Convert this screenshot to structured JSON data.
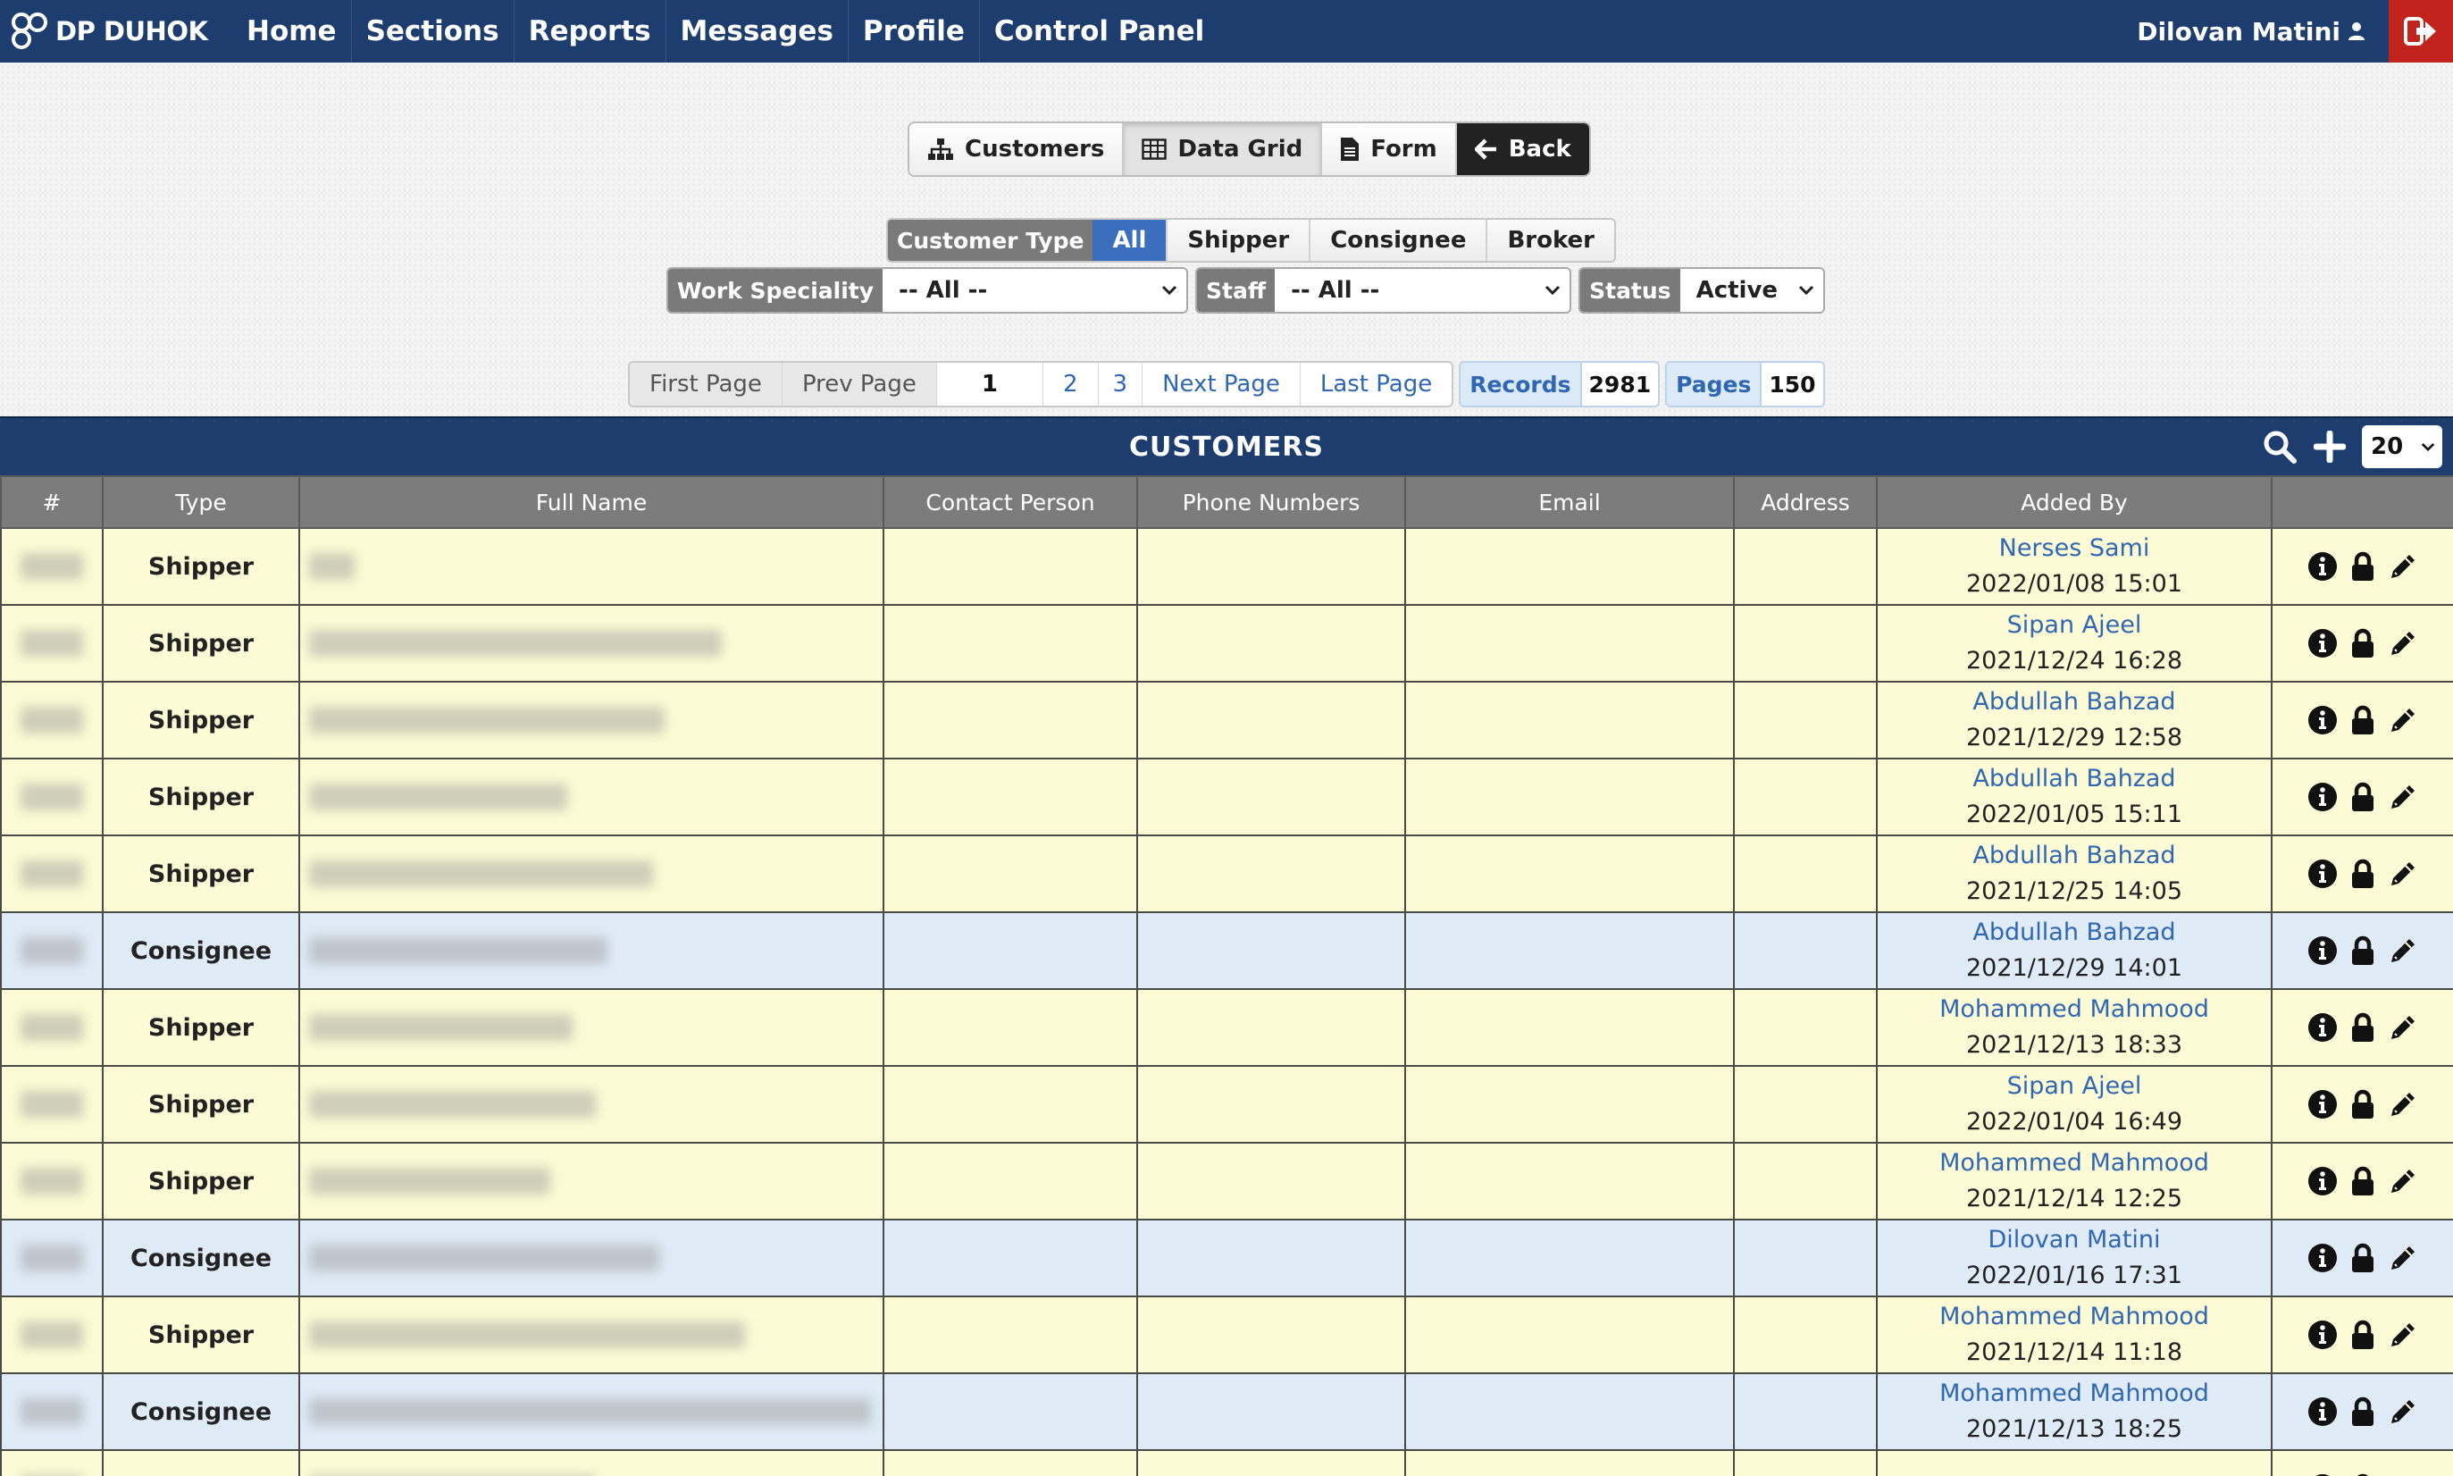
{
  "brand": {
    "name": "DP DUHOK"
  },
  "nav": {
    "items": [
      "Home",
      "Sections",
      "Reports",
      "Messages",
      "Profile",
      "Control Panel"
    ],
    "user": "Dilovan Matini"
  },
  "views": {
    "customers": "Customers",
    "data_grid": "Data Grid",
    "form": "Form",
    "back": "Back"
  },
  "filters": {
    "customer_type_label": "Customer Type",
    "customer_types": [
      "All",
      "Shipper",
      "Consignee",
      "Broker"
    ],
    "customer_type_selected": "All",
    "work_speciality_label": "Work Speciality",
    "work_speciality_value": "-- All --",
    "staff_label": "Staff",
    "staff_value": "-- All --",
    "status_label": "Status",
    "status_value": "Active"
  },
  "pager": {
    "first": "First Page",
    "prev": "Prev Page",
    "pages": [
      "1",
      "2",
      "3"
    ],
    "current": "1",
    "next": "Next Page",
    "last": "Last Page",
    "records_label": "Records",
    "records": "2981",
    "pages_label": "Pages",
    "page_count": "150"
  },
  "table": {
    "title": "CUSTOMERS",
    "page_size": "20",
    "columns": [
      "#",
      "Type",
      "Full Name",
      "Contact Person",
      "Phone Numbers",
      "Email",
      "Address",
      "Added By"
    ],
    "rows": [
      {
        "type": "Shipper",
        "added_by": "Nerses Sami",
        "added_at": "2022/01/08 15:01"
      },
      {
        "type": "Shipper",
        "added_by": "Sipan Ajeel",
        "added_at": "2021/12/24 16:28"
      },
      {
        "type": "Shipper",
        "added_by": "Abdullah Bahzad",
        "added_at": "2021/12/29 12:58"
      },
      {
        "type": "Shipper",
        "added_by": "Abdullah Bahzad",
        "added_at": "2022/01/05 15:11"
      },
      {
        "type": "Shipper",
        "added_by": "Abdullah Bahzad",
        "added_at": "2021/12/25 14:05"
      },
      {
        "type": "Consignee",
        "added_by": "Abdullah Bahzad",
        "added_at": "2021/12/29 14:01"
      },
      {
        "type": "Shipper",
        "added_by": "Mohammed Mahmood",
        "added_at": "2021/12/13 18:33"
      },
      {
        "type": "Shipper",
        "added_by": "Sipan Ajeel",
        "added_at": "2022/01/04 16:49"
      },
      {
        "type": "Shipper",
        "added_by": "Mohammed Mahmood",
        "added_at": "2021/12/14 12:25"
      },
      {
        "type": "Consignee",
        "added_by": "Dilovan Matini",
        "added_at": "2022/01/16 17:31"
      },
      {
        "type": "Shipper",
        "added_by": "Mohammed Mahmood",
        "added_at": "2021/12/14 11:18"
      },
      {
        "type": "Consignee",
        "added_by": "Mohammed Mahmood",
        "added_at": "2021/12/13 18:25"
      },
      {
        "type": "",
        "added_by": "Abdullah Bahzad",
        "added_at": ""
      }
    ]
  },
  "colors": {
    "navbar": "#1d3d6e",
    "logout": "#c0241c",
    "accent": "#3b6fbe",
    "link": "#2f67b2",
    "shipper_row": "#fdfbd5",
    "consignee_row": "#dfebf6"
  },
  "icons": [
    "user-icon",
    "logout-icon",
    "sitemap-icon",
    "table-icon",
    "file-icon",
    "arrow-left-icon",
    "search-icon",
    "plus-icon",
    "info-icon",
    "lock-icon",
    "pencil-icon"
  ]
}
